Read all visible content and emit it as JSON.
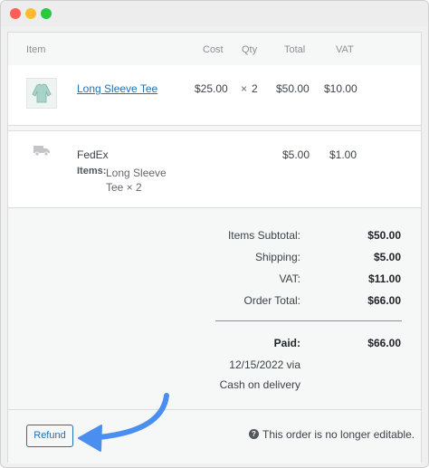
{
  "columns": {
    "item": "Item",
    "cost": "Cost",
    "qty": "Qty",
    "total": "Total",
    "vat": "VAT"
  },
  "line_item": {
    "name": "Long Sleeve Tee",
    "cost": "$25.00",
    "qty_symbol": "×",
    "qty": "2",
    "total": "$50.00",
    "vat": "$10.00",
    "thumbnail_icon": "long-sleeve-tee-thumbnail"
  },
  "shipping_line": {
    "method": "FedEx",
    "total": "$5.00",
    "vat": "$1.00",
    "items_label": "Items:",
    "items_line1": "Long Sleeve",
    "items_line2": "Tee × 2",
    "icon": "truck-icon"
  },
  "totals": {
    "subtotal_label": "Items Subtotal:",
    "subtotal_value": "$50.00",
    "shipping_label": "Shipping:",
    "shipping_value": "$5.00",
    "vat_label": "VAT:",
    "vat_value": "$11.00",
    "order_total_label": "Order Total:",
    "order_total_value": "$66.00",
    "paid_label": "Paid:",
    "paid_value": "$66.00",
    "paid_date": "12/15/2022 via",
    "paid_method": "Cash on delivery"
  },
  "footer": {
    "refund_label": "Refund",
    "notice": "This order is no longer editable.",
    "notice_icon": "help-icon"
  },
  "colors": {
    "link": "#2271b1",
    "annotation_arrow": "#4a8ef0"
  }
}
